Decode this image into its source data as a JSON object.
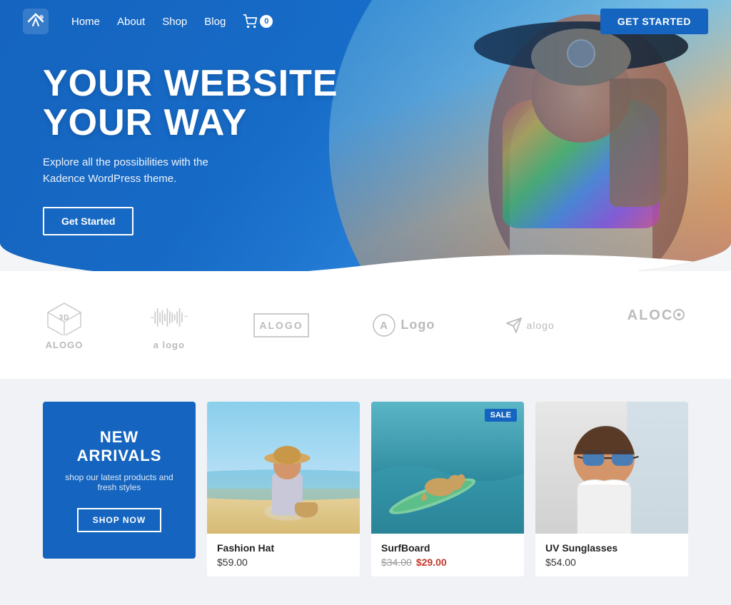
{
  "navbar": {
    "logo_text": "K",
    "nav_items": [
      {
        "label": "Home",
        "href": "#"
      },
      {
        "label": "About",
        "href": "#"
      },
      {
        "label": "Shop",
        "href": "#"
      },
      {
        "label": "Blog",
        "href": "#"
      }
    ],
    "cart_count": "0",
    "cta_label": "GET STARTED"
  },
  "hero": {
    "title_line1": "YOUR WEBSITE",
    "title_line2": "YOUR WAY",
    "subtitle": "Explore all the possibilities with the\nKadence WordPress theme.",
    "cta_label": "Get Started"
  },
  "logos": [
    {
      "id": "logo1",
      "text": "ALOGO",
      "type": "cube"
    },
    {
      "id": "logo2",
      "text": "a logo",
      "type": "wave"
    },
    {
      "id": "logo3",
      "text": "ALOGO",
      "type": "box"
    },
    {
      "id": "logo4",
      "text": "Logo",
      "type": "circle-a"
    },
    {
      "id": "logo5",
      "text": "alogo",
      "type": "arrow"
    },
    {
      "id": "logo6",
      "text": "ALOGO",
      "type": "text-logo"
    }
  ],
  "products_section": {
    "new_arrivals": {
      "title": "NEW ARRIVALS",
      "subtitle": "shop our latest products and fresh styles",
      "cta": "SHOP NOW"
    },
    "products": [
      {
        "name": "Fashion Hat",
        "price": "$59.00",
        "sale": false,
        "image_type": "beach"
      },
      {
        "name": "SurfBoard",
        "price_original": "$34.00",
        "price_sale": "$29.00",
        "sale": true,
        "image_type": "surf"
      },
      {
        "name": "UV Sunglasses",
        "price": "$54.00",
        "sale": false,
        "image_type": "glasses"
      }
    ],
    "sale_badge": "SALE"
  }
}
